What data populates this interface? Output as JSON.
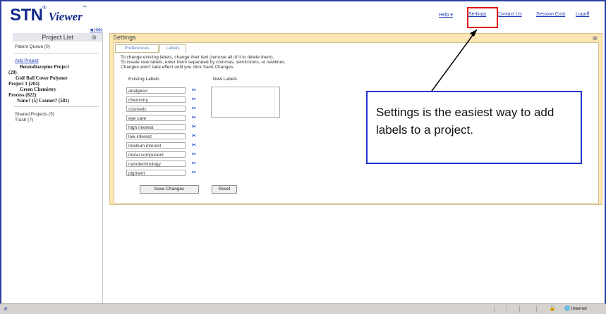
{
  "app": {
    "logo_main": "STN",
    "logo_reg": "®",
    "logo_sub": "Viewer",
    "logo_tm": "™"
  },
  "topnav": [
    "Help ▾",
    "Settings",
    "Contact Us",
    "Session Cost",
    "Logoff"
  ],
  "hide_link": "◀ Hide",
  "sidebar": {
    "title": "Project List",
    "patent_queue": "Patent Queue (0)",
    "add_project": "Add Project",
    "projects": [
      "Benzodiazepine Project",
      "(29)",
      "Golf Ball Cover Polymer",
      "Project 1 (204)",
      "Green Chemistry",
      "Process (822)",
      "Nano? (5) Cosmet? (581)"
    ],
    "shared": "Shared Projects (5)",
    "trash": "Trash (7)"
  },
  "settings": {
    "title": "Settings",
    "tabs": [
      "Preferences",
      "Labels"
    ],
    "instructions": [
      "To change existing labels, change their text (remove all of it to delete them).",
      "To create new labels, enter them separated by commas, semicolons, or newlines.",
      "Changes won't take effect until you click Save Changes."
    ],
    "existing_header": "Existing Labels",
    "new_header": "New Labels",
    "labels": [
      "analgesic",
      "chemistry",
      "cosmetic",
      "eye care",
      "high interest",
      "low interest",
      "medium interest",
      "metal component",
      "nanotechnology",
      "pigment"
    ],
    "save_button": "Save Changes",
    "reset_button": "Reset"
  },
  "callout_text": "Settings is the easiest way to add labels to a project.",
  "statusbar": {
    "zone": "Internet"
  },
  "colors": {
    "link": "#1c3db8",
    "panel": "#fbe6b4",
    "highlight": "#e0141a",
    "callout_border": "#2233cc"
  }
}
